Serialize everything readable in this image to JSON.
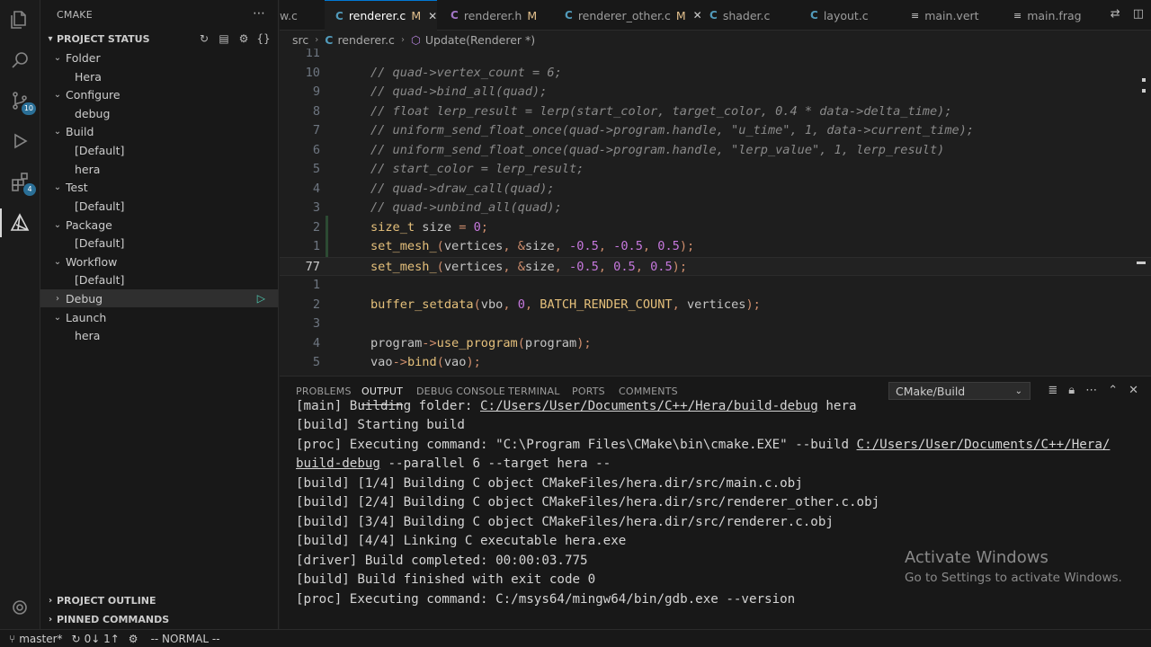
{
  "activity_bar": {
    "badges": [
      "10",
      "4"
    ]
  },
  "sidebar": {
    "title": "CMAKE",
    "section_title": "PROJECT STATUS",
    "tree": [
      {
        "label": "Folder",
        "type": "group"
      },
      {
        "label": "Hera",
        "type": "child"
      },
      {
        "label": "Configure",
        "type": "group"
      },
      {
        "label": "debug",
        "type": "child"
      },
      {
        "label": "Build",
        "type": "group"
      },
      {
        "label": "[Default]",
        "type": "child"
      },
      {
        "label": "hera",
        "type": "child"
      },
      {
        "label": "Test",
        "type": "group"
      },
      {
        "label": "[Default]",
        "type": "child"
      },
      {
        "label": "Package",
        "type": "group"
      },
      {
        "label": "[Default]",
        "type": "child"
      },
      {
        "label": "Workflow",
        "type": "group"
      },
      {
        "label": "[Default]",
        "type": "child"
      },
      {
        "label": "Debug",
        "type": "collapsed"
      },
      {
        "label": "Launch",
        "type": "group"
      },
      {
        "label": "hera",
        "type": "child"
      }
    ],
    "project_outline": "PROJECT OUTLINE",
    "pinned_commands": "PINNED COMMANDS"
  },
  "tabs": [
    {
      "label": "w.c"
    },
    {
      "label": "renderer.c",
      "modified": "M",
      "active": true
    },
    {
      "label": "renderer.h",
      "modified": "M"
    },
    {
      "label": "renderer_other.c",
      "modified": "M"
    },
    {
      "label": "shader.c"
    },
    {
      "label": "layout.c"
    },
    {
      "label": "main.vert"
    },
    {
      "label": "main.frag"
    }
  ],
  "breadcrumb": {
    "folder": "src",
    "file": "renderer.c",
    "symbol": "Update(Renderer *)"
  },
  "editor": {
    "current_line_number": "77",
    "lines": [
      {
        "n": "11",
        "code": ""
      },
      {
        "n": "10",
        "code": "// quad->vertex_count = 6;"
      },
      {
        "n": "9",
        "code": "// quad->bind_all(quad);"
      },
      {
        "n": "8",
        "code": "// float lerp_result = lerp(start_color, target_color, 0.4 * data->delta_time);"
      },
      {
        "n": "7",
        "code": "// uniform_send_float_once(quad->program.handle, \"u_time\", 1, data->current_time);"
      },
      {
        "n": "6",
        "code": "// uniform_send_float_once(quad->program.handle, \"lerp_value\", 1, lerp_result)"
      },
      {
        "n": "5",
        "code": "// start_color = lerp_result;"
      },
      {
        "n": "4",
        "code": "// quad->draw_call(quad);"
      },
      {
        "n": "3",
        "code": "// quad->unbind_all(quad);"
      },
      {
        "n": "2",
        "code": "size_t size = 0;"
      },
      {
        "n": "1",
        "code": "set_mesh_(vertices, &size, -0.5, -0.5, 0.5);"
      },
      {
        "n": "77",
        "code": "set_mesh_(vertices, &size, -0.5, 0.5, 0.5);"
      },
      {
        "n": "1",
        "code": ""
      },
      {
        "n": "2",
        "code": "buffer_setdata(vbo, 0, BATCH_RENDER_COUNT, vertices);"
      },
      {
        "n": "3",
        "code": ""
      },
      {
        "n": "4",
        "code": "program->use_program(program);"
      },
      {
        "n": "5",
        "code": "vao->bind(vao);"
      }
    ]
  },
  "panel": {
    "tabs": [
      "PROBLEMS",
      "OUTPUT",
      "DEBUG CONSOLE",
      "TERMINAL",
      "PORTS",
      "COMMENTS"
    ],
    "active_tab": "OUTPUT",
    "channel": "CMake/Build",
    "output": [
      "[main] Building folder: C:/Users/User/Documents/C++/Hera/build-debug hera",
      "[build] Starting build",
      "[proc] Executing command: \"C:\\Program Files\\CMake\\bin\\cmake.EXE\" --build C:/Users/User/Documents/C++/Hera/",
      "build-debug --parallel 6 --target hera --",
      "[build] [1/4] Building C object CMakeFiles/hera.dir/src/main.c.obj",
      "[build] [2/4] Building C object CMakeFiles/hera.dir/src/renderer_other.c.obj",
      "[build] [3/4] Building C object CMakeFiles/hera.dir/src/renderer.c.obj",
      "[build] [4/4] Linking C executable hera.exe",
      "[driver] Build completed: 00:00:03.775",
      "[build] Build finished with exit code 0",
      "[proc] Executing command: C:/msys64/mingw64/bin/gdb.exe --version"
    ],
    "watermark_title": "Activate Windows",
    "watermark_sub": "Go to Settings to activate Windows."
  },
  "status": {
    "branch": "master*",
    "sync": "0↓ 1↑",
    "mode": "-- NORMAL --"
  }
}
